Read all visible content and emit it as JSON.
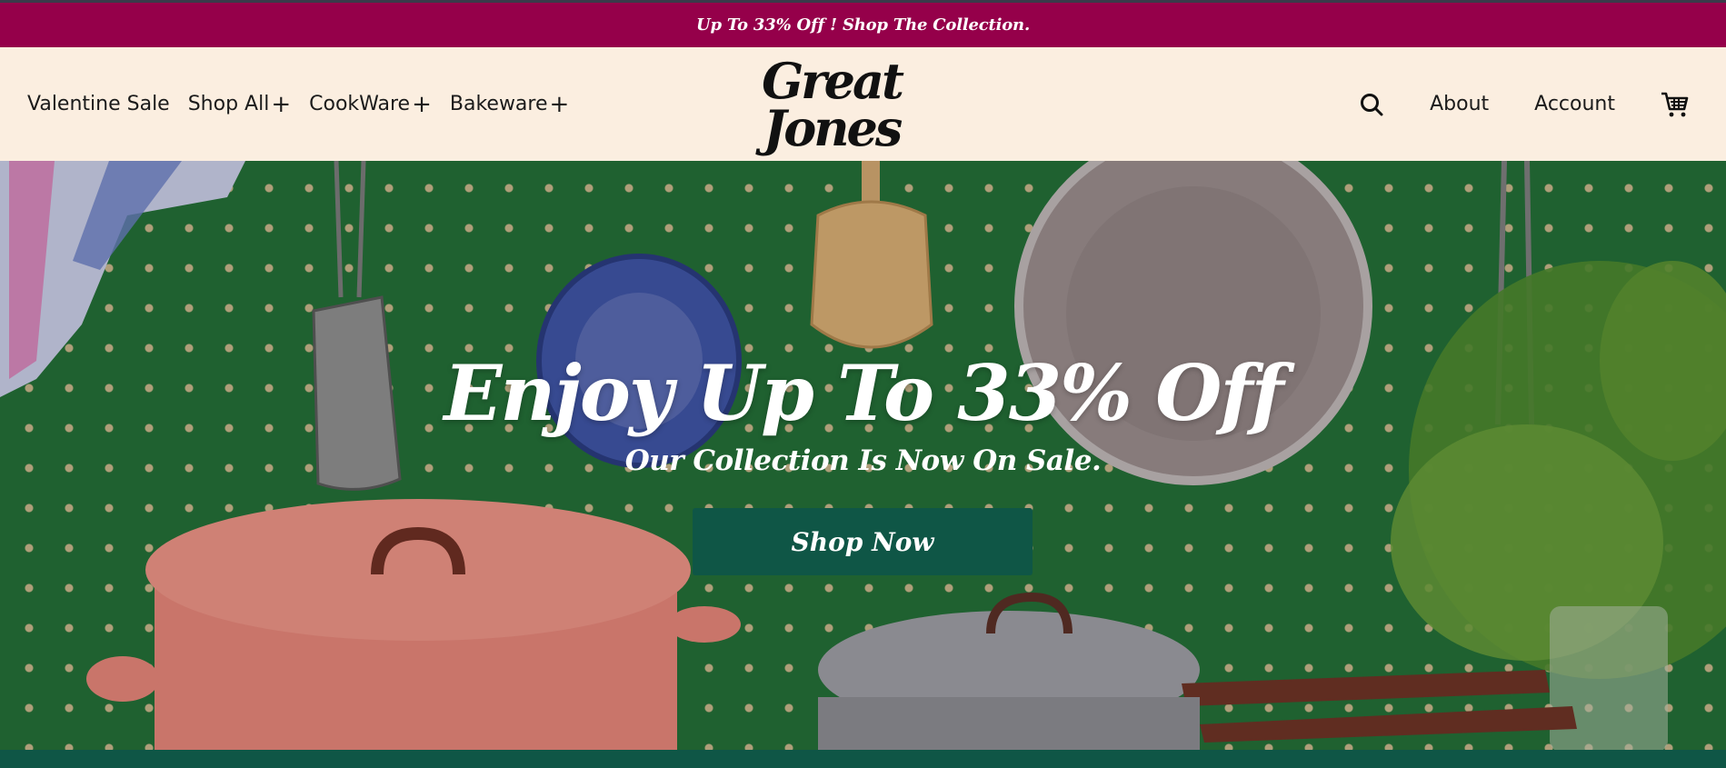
{
  "announcement": {
    "text": "Up To 33% Off ! Shop The Collection."
  },
  "header": {
    "nav_left": [
      {
        "label": "Valentine Sale",
        "has_plus": false
      },
      {
        "label": "Shop All",
        "has_plus": true
      },
      {
        "label": "CookWare",
        "has_plus": true
      },
      {
        "label": "Bakeware",
        "has_plus": true
      }
    ],
    "plus_glyph": "+",
    "logo": {
      "line1": "Great",
      "line2": "Jones"
    },
    "nav_right": {
      "search_icon": "search-icon",
      "about_label": "About",
      "account_label": "Account",
      "cart_icon": "cart-icon"
    }
  },
  "hero": {
    "title": "Enjoy Up To 33% Off",
    "subtitle": "Our Collection Is Now On Sale.",
    "cta_label": "Shop Now",
    "background": "kitchen-pegboard-photo"
  },
  "colors": {
    "announcement_bg": "#95004a",
    "header_bg": "#fbeee0",
    "cta_bg": "#0f5646",
    "pegboard_green": "#246f37"
  }
}
